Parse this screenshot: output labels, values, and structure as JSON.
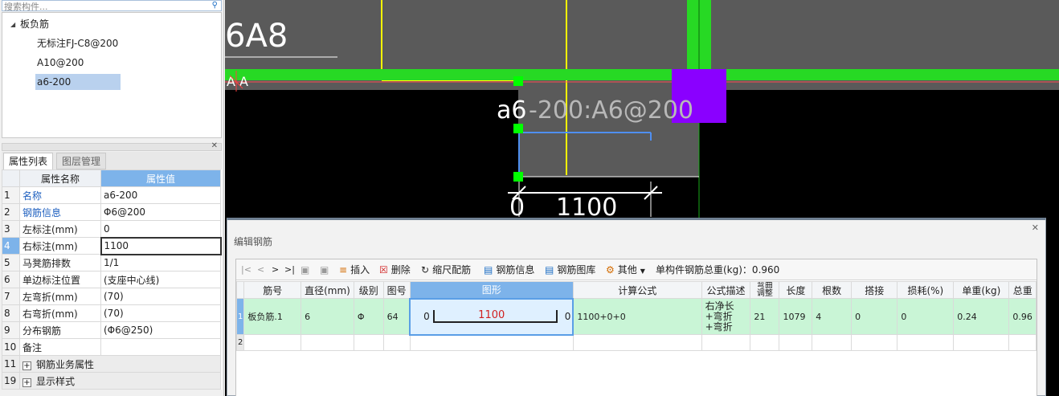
{
  "left_panel": {
    "search_placeholder": "搜索构件...",
    "tree": {
      "group": "板负筋",
      "items": [
        "无标注FJ-C8@200",
        "A10@200",
        "a6-200"
      ],
      "selected_index": 2
    },
    "tabs": [
      "属性列表",
      "图层管理"
    ],
    "props": {
      "header_name": "属性名称",
      "header_value": "属性值",
      "rows": [
        {
          "no": "1",
          "name": "名称",
          "value": "a6-200"
        },
        {
          "no": "2",
          "name": "钢筋信息",
          "value": "Φ6@200"
        },
        {
          "no": "3",
          "name": "左标注(mm)",
          "value": "0"
        },
        {
          "no": "4",
          "name": "右标注(mm)",
          "value": "1100"
        },
        {
          "no": "5",
          "name": "马凳筋排数",
          "value": "1/1"
        },
        {
          "no": "6",
          "name": "单边标注位置",
          "value": "(支座中心线)"
        },
        {
          "no": "7",
          "name": "左弯折(mm)",
          "value": "(70)"
        },
        {
          "no": "8",
          "name": "右弯折(mm)",
          "value": "(70)"
        },
        {
          "no": "9",
          "name": "分布钢筋",
          "value": "(Φ6@250)"
        },
        {
          "no": "10",
          "name": "备注",
          "value": ""
        },
        {
          "no": "11",
          "name": "钢筋业务属性",
          "value": ""
        },
        {
          "no": "19",
          "name": "显示样式",
          "value": ""
        }
      ]
    }
  },
  "cad": {
    "label_main": "6A8",
    "label_small": "A A",
    "label_rebar_white": "a6",
    "label_rebar_gray": "-200:A6@200",
    "dim_left": "0",
    "dim_right": "1100",
    "colors": {
      "background": "#000000",
      "slab": "#5a5a5a",
      "beam": "#27d924",
      "column": "#8a00ff",
      "wall": "#ffff00",
      "rebar": "#4f8ff0",
      "grip": "#00ff00"
    }
  },
  "dialog": {
    "title": "编辑钢筋",
    "toolbar": {
      "nav": [
        "|<",
        "<",
        ">",
        ">|"
      ],
      "insert": "插入",
      "delete": "删除",
      "scale": "缩尺配筋",
      "info": "钢筋信息",
      "library": "钢筋图库",
      "other": "其他",
      "total": "单构件钢筋总重(kg)：0.960"
    },
    "columns": [
      "筋号",
      "直径(mm)",
      "级别",
      "图号",
      "图形",
      "计算公式",
      "公式描述",
      "弯曲调整",
      "长度",
      "根数",
      "搭接",
      "损耗(%)",
      "单重(kg)",
      "总重"
    ],
    "rows": [
      {
        "rn": "1",
        "bar_no": "板负筋.1",
        "dia": "6",
        "grade": "Φ",
        "fig": "64",
        "shape_left": "0",
        "shape_len": "1100",
        "shape_right": "0",
        "formula": "1100+0+0",
        "desc": "右净长+弯折+弯折",
        "bend": "21",
        "length": "1079",
        "count": "4",
        "lap": "0",
        "loss": "0",
        "unit_w": "0.24",
        "total_w": "0.96"
      },
      {
        "rn": "2"
      }
    ]
  }
}
